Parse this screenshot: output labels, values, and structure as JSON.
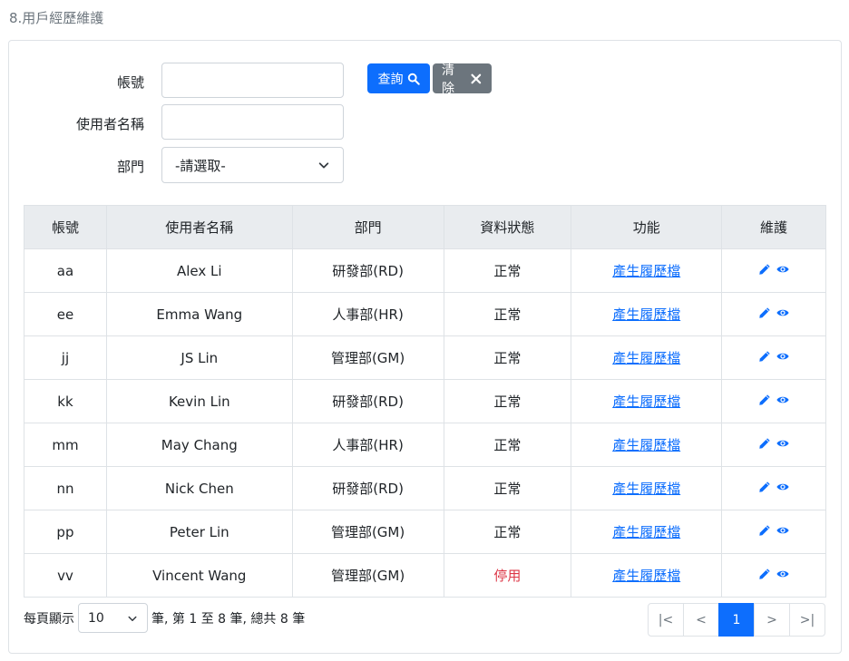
{
  "page": {
    "title": "8.用戶經歷維護"
  },
  "search": {
    "account_label": "帳號",
    "user_label": "使用者名稱",
    "dept_label": "部門",
    "account_value": "",
    "user_value": "",
    "dept_selected": "-請選取-",
    "search_button": "查詢",
    "clear_button": "清除"
  },
  "table": {
    "headers": [
      "帳號",
      "使用者名稱",
      "部門",
      "資料狀態",
      "功能",
      "維護"
    ],
    "rows": [
      {
        "account": "aa",
        "name": "Alex Li",
        "dept": "研發部(RD)",
        "status": "正常",
        "action": "產生履歷檔"
      },
      {
        "account": "ee",
        "name": "Emma Wang",
        "dept": "人事部(HR)",
        "status": "正常",
        "action": "產生履歷檔"
      },
      {
        "account": "jj",
        "name": "JS Lin",
        "dept": "管理部(GM)",
        "status": "正常",
        "action": "產生履歷檔"
      },
      {
        "account": "kk",
        "name": "Kevin Lin",
        "dept": "研發部(RD)",
        "status": "正常",
        "action": "產生履歷檔"
      },
      {
        "account": "mm",
        "name": "May Chang",
        "dept": "人事部(HR)",
        "status": "正常",
        "action": "產生履歷檔"
      },
      {
        "account": "nn",
        "name": "Nick Chen",
        "dept": "研發部(RD)",
        "status": "正常",
        "action": "產生履歷檔"
      },
      {
        "account": "pp",
        "name": "Peter Lin",
        "dept": "管理部(GM)",
        "status": "正常",
        "action": "產生履歷檔"
      },
      {
        "account": "vv",
        "name": "Vincent Wang",
        "dept": "管理部(GM)",
        "status": "停用",
        "action": "產生履歷檔"
      }
    ]
  },
  "footer": {
    "per_page_label": "每頁顯示",
    "page_size": "10",
    "summary": "筆, 第 1 至 8 筆, 總共 8 筆"
  },
  "pagination": {
    "first": "|<",
    "prev": "<",
    "current": "1",
    "next": ">",
    "last": ">|"
  },
  "colors": {
    "primary": "#0d6efd",
    "secondary": "#6c757d",
    "danger": "#dc3545"
  },
  "icons": {
    "search": "search-icon",
    "clear": "close-icon",
    "dropdown": "chevron-down-icon",
    "edit": "pencil-icon",
    "view": "eye-icon"
  }
}
